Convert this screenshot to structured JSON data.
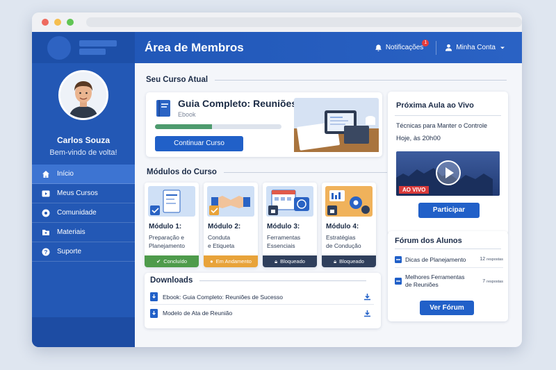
{
  "app": {
    "title": "Área de Membros"
  },
  "header": {
    "notifications_label": "Notificações",
    "notifications_count": "1",
    "account_label": "Minha Conta"
  },
  "user": {
    "name": "Carlos Souza",
    "greeting": "Bem-vindo de volta!"
  },
  "sidebar": {
    "items": [
      {
        "label": "Início",
        "icon": "home-icon",
        "active": true
      },
      {
        "label": "Meus Cursos",
        "icon": "play-icon"
      },
      {
        "label": "Comunidade",
        "icon": "community-icon"
      },
      {
        "label": "Materiais",
        "icon": "folder-icon"
      },
      {
        "label": "Suporte",
        "icon": "help-icon"
      }
    ]
  },
  "current_course": {
    "section_title": "Seu Curso Atual",
    "title": "Guia Completo: Reuniões de Sucesso",
    "type": "Ebook",
    "progress": 0.45,
    "button": "Continuar Curso"
  },
  "modules": {
    "section_title": "Módulos do Curso",
    "items": [
      {
        "number": "Módulo 1:",
        "line1": "Preparação e",
        "line2": "Planejamento",
        "status": "Concluído",
        "status_color": "#4e9b4b"
      },
      {
        "number": "Módulo 2:",
        "line1": "Conduta",
        "line2": "e Etiqueta",
        "status": "Em Andamento",
        "status_color": "#e8a33a"
      },
      {
        "number": "Módulo 3:",
        "line1": "Ferramentas",
        "line2": "Essenciais",
        "status": "Bloqueado",
        "status_color": "#2f3f5c"
      },
      {
        "number": "Módulo 4:",
        "line1": "Estratégias",
        "line2": "de Condução",
        "status": "Bloqueado",
        "status_color": "#2f3f5c"
      }
    ]
  },
  "downloads": {
    "section_title": "Downloads",
    "items": [
      "Ebook: Guia Completo: Reuniões de Sucesso",
      "Modelo de Ata de Reunião"
    ]
  },
  "live": {
    "title": "Próxima Aula ao Vivo",
    "topic": "Técnicas para Manter o Controle",
    "time": "Hoje, às 20h00",
    "badge": "AO VIVO",
    "button": "Participar"
  },
  "forum": {
    "title": "Fórum dos Alunos",
    "items": [
      {
        "line1": "Dicas de Planejamento",
        "line2": "",
        "count": "12",
        "count_label": "respostas"
      },
      {
        "line1": "Melhores Ferramentas",
        "line2": "de Reuniões",
        "count": "7",
        "count_label": "respostas"
      }
    ],
    "button": "Ver Fórum"
  },
  "colors": {
    "primary": "#2160c8",
    "sidebar": "#2358b5",
    "success": "#4e9b4b",
    "warning": "#e8a33a",
    "locked": "#2f3f5c",
    "live": "#d93a3a"
  }
}
